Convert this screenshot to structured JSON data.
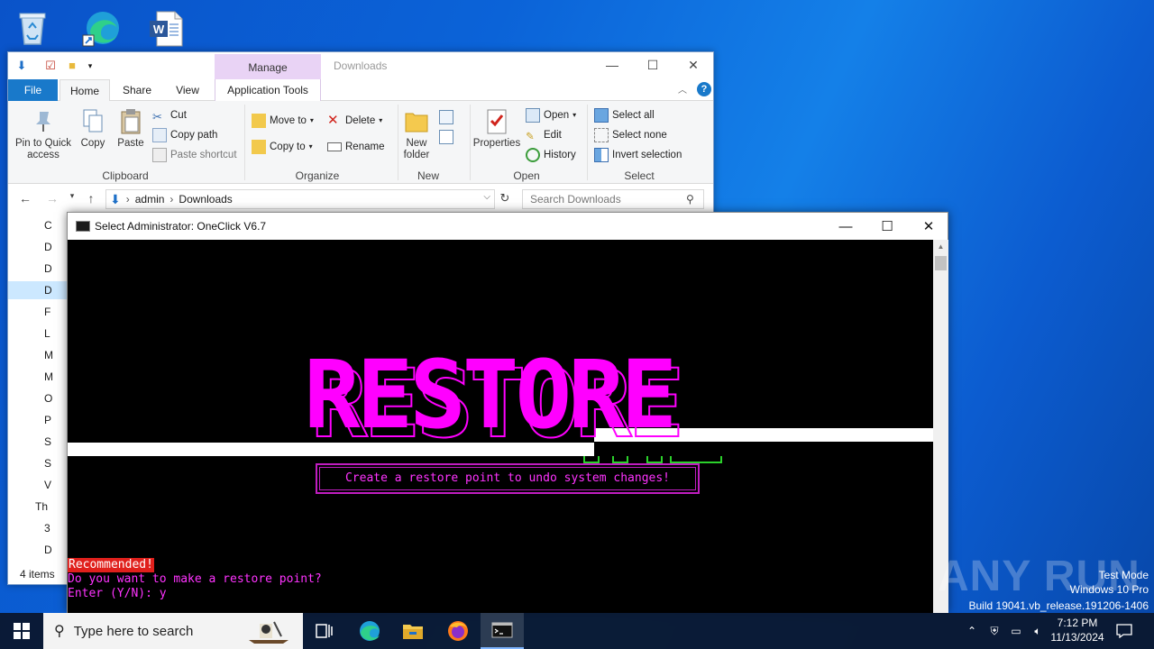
{
  "desktop": {
    "icons": [
      "recycle-bin-icon",
      "edge-shortcut-icon",
      "word-document-icon"
    ]
  },
  "explorer": {
    "title": "Downloads",
    "manage_tab": "Manage",
    "tabs": {
      "file": "File",
      "home": "Home",
      "share": "Share",
      "view": "View",
      "app_tools": "Application Tools"
    },
    "clipboard": {
      "pin_label": "Pin to Quick access",
      "copy": "Copy",
      "paste": "Paste",
      "cut": "Cut",
      "copy_path": "Copy path",
      "paste_shortcut": "Paste shortcut",
      "group": "Clipboard"
    },
    "organize": {
      "move_to": "Move to",
      "copy_to": "Copy to",
      "delete": "Delete",
      "rename": "Rename",
      "group": "Organize"
    },
    "new": {
      "new_folder": "New folder",
      "group": "New"
    },
    "open": {
      "properties": "Properties",
      "open": "Open",
      "edit": "Edit",
      "history": "History",
      "group": "Open"
    },
    "select": {
      "select_all": "Select all",
      "select_none": "Select none",
      "invert": "Invert selection",
      "group": "Select"
    },
    "address": {
      "crumbs": [
        "admin",
        "Downloads"
      ],
      "search_placeholder": "Search Downloads"
    },
    "nav_items": [
      "C",
      "D",
      "D",
      "D",
      "F",
      "L",
      "M",
      "M",
      "O",
      "P",
      "S",
      "S",
      "V",
      "Th",
      "3",
      "D"
    ],
    "status": "4 items"
  },
  "console": {
    "title": "Select Administrator:  OneClick V6.7",
    "banner": "RESTORE",
    "box_text": "Create a restore point to undo system changes!",
    "recommended": "Recommended!",
    "question": "Do you want to make a restore point?",
    "prompt": "Enter (Y/N): y"
  },
  "watermark": {
    "brand": "ANY RUN",
    "line1": "Test Mode",
    "line2": "Windows 10 Pro",
    "line3": "Build 19041.vb_release.191206-1406"
  },
  "taskbar": {
    "search_placeholder": "Type here to search",
    "time": "7:12 PM",
    "date": "11/13/2024"
  },
  "colors": {
    "console_accent": "#ff00ff",
    "recommended_bg": "#e0201c",
    "ribbon_file_tab": "#1979ca",
    "manage_tab_bg": "#e9d3f5"
  }
}
